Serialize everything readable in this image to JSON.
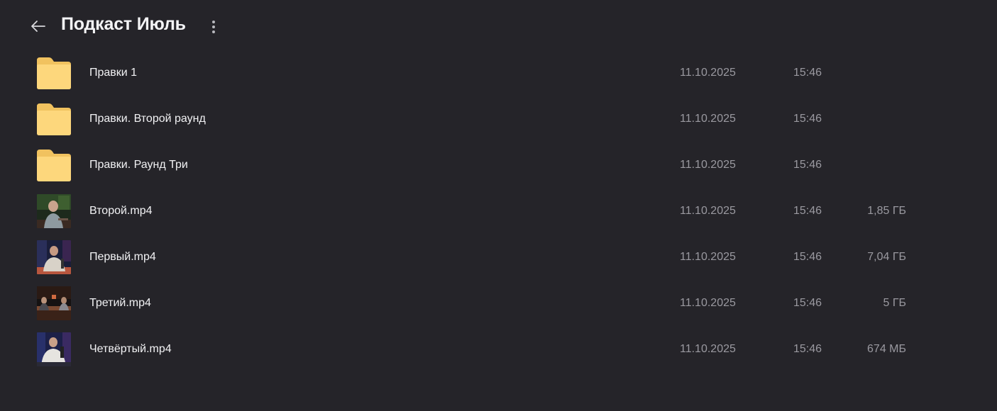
{
  "header": {
    "title": "Подкаст Июль",
    "back_icon": "arrow-left-icon",
    "more_icon": "more-vertical-icon"
  },
  "colors": {
    "background": "#252429",
    "folder": "#fdd77c",
    "text_primary": "#f2f2f4",
    "text_secondary": "#9a99a0"
  },
  "files": [
    {
      "type": "folder",
      "icon": "folder-icon",
      "name": "Правки 1",
      "date": "11.10.2025",
      "time": "15:46",
      "size": ""
    },
    {
      "type": "folder",
      "icon": "folder-icon",
      "name": "Правки. Второй раунд",
      "date": "11.10.2025",
      "time": "15:46",
      "size": ""
    },
    {
      "type": "folder",
      "icon": "folder-icon",
      "name": "Правки. Раунд Три",
      "date": "11.10.2025",
      "time": "15:46",
      "size": ""
    },
    {
      "type": "video",
      "icon": "video-thumbnail",
      "name": "Второй.mp4",
      "date": "11.10.2025",
      "time": "15:46",
      "size": "1,85 ГБ"
    },
    {
      "type": "video",
      "icon": "video-thumbnail",
      "name": "Первый.mp4",
      "date": "11.10.2025",
      "time": "15:46",
      "size": "7,04 ГБ"
    },
    {
      "type": "video",
      "icon": "video-thumbnail",
      "name": "Третий.mp4",
      "date": "11.10.2025",
      "time": "15:46",
      "size": "5 ГБ"
    },
    {
      "type": "video",
      "icon": "video-thumbnail",
      "name": "Четвёртый.mp4",
      "date": "11.10.2025",
      "time": "15:46",
      "size": "674 МБ"
    }
  ]
}
